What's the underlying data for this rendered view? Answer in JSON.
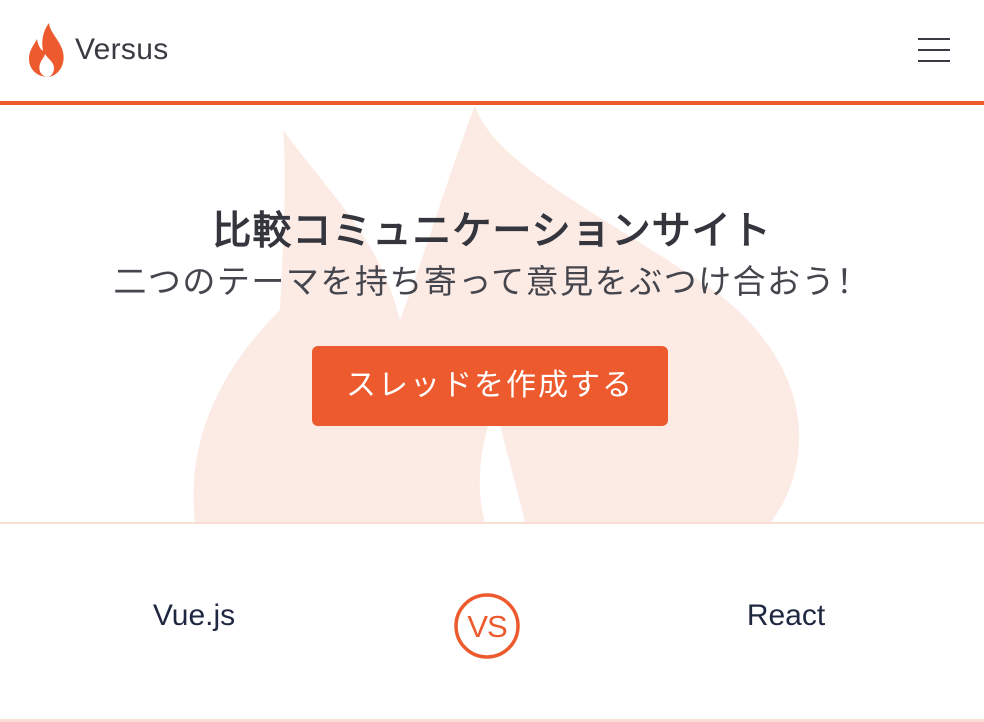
{
  "header": {
    "brand_name": "Versus",
    "brand_icon": "flame-icon",
    "menu_icon": "hamburger-menu-icon"
  },
  "hero": {
    "title": "比較コミュニケーションサイト",
    "subtitle": "二つのテーマを持ち寄って意見をぶつけ合おう！",
    "cta_label": "スレッドを作成する",
    "background_icon": "flame-watermark"
  },
  "versus": {
    "left_topic": "Vue.js",
    "badge_text": "VS",
    "right_topic": "React"
  },
  "colors": {
    "accent": "#ec5a2d",
    "watermark": "#fcebe5",
    "text_dark": "#35353d",
    "topic_text": "#1f2741"
  }
}
